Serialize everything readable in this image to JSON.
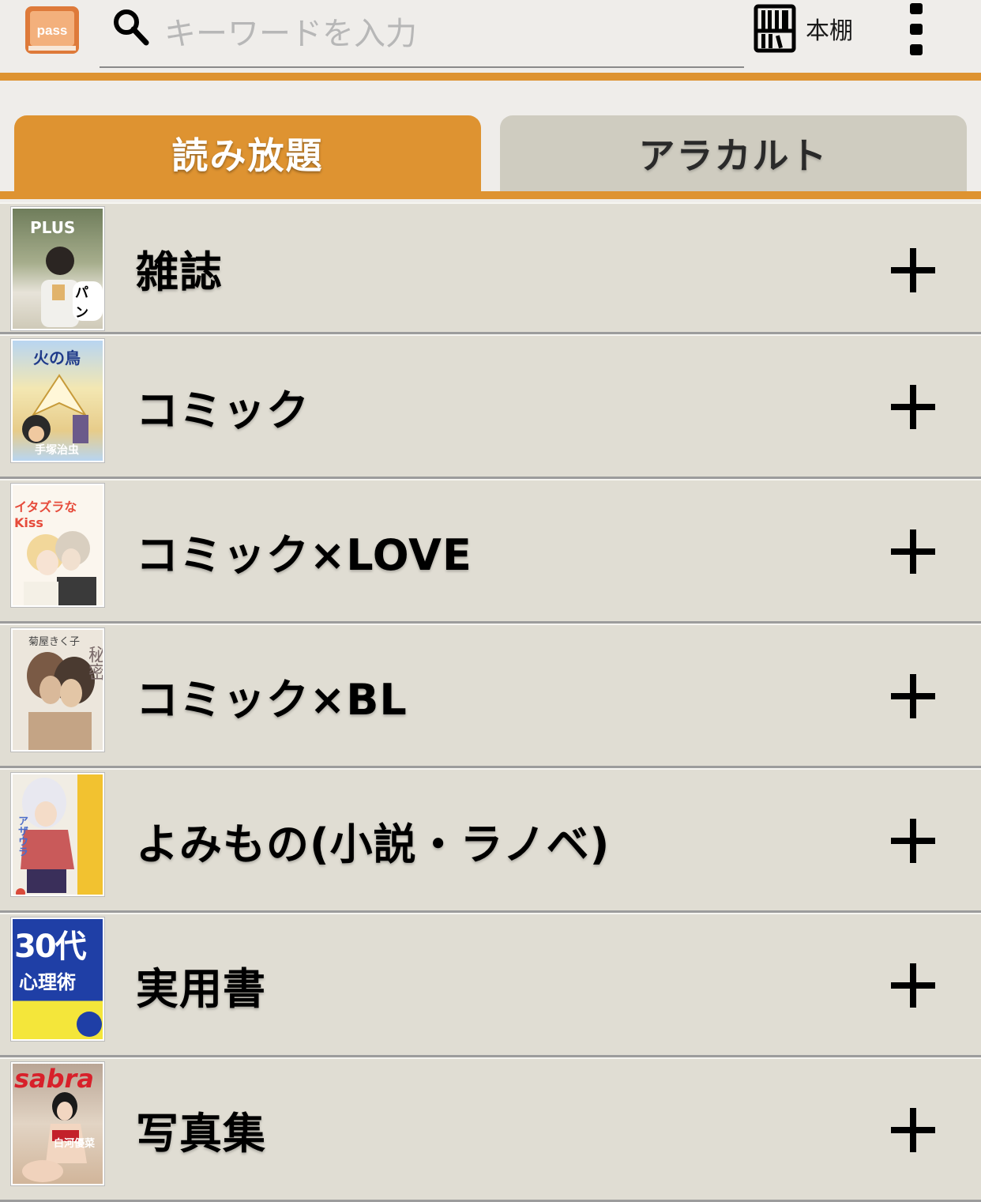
{
  "header": {
    "logo_text": "pass",
    "search_placeholder": "キーワードを入力",
    "shelf_label": "本棚"
  },
  "tabs": [
    {
      "label": "読み放題",
      "active": true
    },
    {
      "label": "アラカルト",
      "active": false
    }
  ],
  "categories": [
    {
      "label": "雑誌",
      "cover_text": "PLUS",
      "cover_sub": "パン"
    },
    {
      "label": "コミック",
      "cover_text": "火の鳥",
      "cover_sub": "手塚治虫"
    },
    {
      "label": "コミック×LOVE",
      "cover_text": "イタズラなKiss",
      "cover_sub": ""
    },
    {
      "label": "コミック×BL",
      "cover_text": "秘密",
      "cover_sub": "菊屋きく子"
    },
    {
      "label": "よみもの(小説・ラノベ)",
      "cover_text": "アザウラ",
      "cover_sub": ""
    },
    {
      "label": "実用書",
      "cover_text": "30代",
      "cover_sub": "心理術"
    },
    {
      "label": "写真集",
      "cover_text": "sabra",
      "cover_sub": "白河優菜"
    }
  ],
  "colors": {
    "accent": "#de9331",
    "row_bg": "#e0ddd3",
    "inactive_tab": "#cfccc0",
    "background": "#efedea"
  }
}
